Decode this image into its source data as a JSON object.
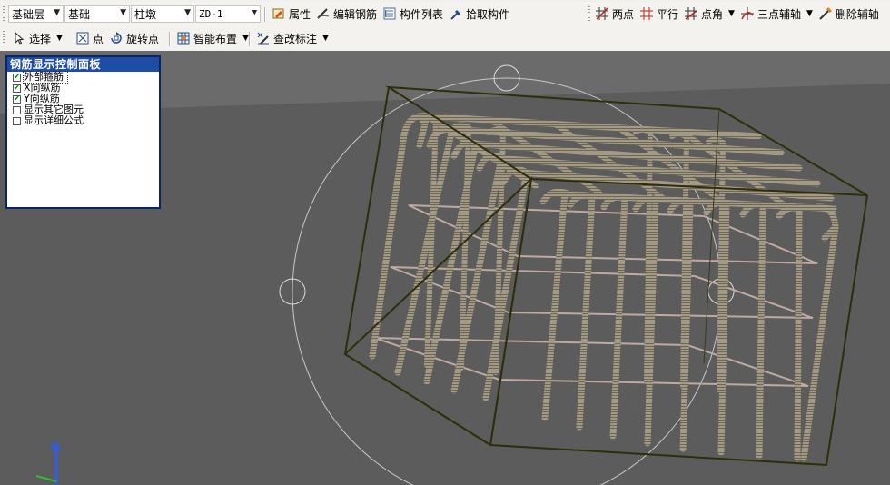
{
  "toolbar1": {
    "combos": [
      {
        "value": "基础层"
      },
      {
        "value": "基础"
      },
      {
        "value": "柱墩"
      },
      {
        "value": "ZD-1"
      }
    ],
    "buttons": [
      {
        "label": "属性",
        "icon": "properties-icon"
      },
      {
        "label": "编辑钢筋",
        "icon": "edit-rebar-icon"
      },
      {
        "label": "构件列表",
        "icon": "component-list-icon"
      },
      {
        "label": "拾取构件",
        "icon": "pick-component-icon"
      }
    ],
    "right_buttons": [
      {
        "label": "两点",
        "icon": "two-point-axis-icon"
      },
      {
        "label": "平行",
        "icon": "parallel-axis-icon"
      },
      {
        "label": "点角",
        "icon": "point-angle-axis-icon"
      },
      {
        "label": "三点辅轴",
        "icon": "three-point-axis-icon"
      },
      {
        "label": "删除辅轴",
        "icon": "delete-axis-icon"
      }
    ]
  },
  "toolbar2": {
    "buttons": [
      {
        "label": "选择",
        "icon": "select-pointer-icon"
      },
      {
        "label": "点",
        "icon": "point-icon"
      },
      {
        "label": "旋转点",
        "icon": "rotate-point-icon"
      },
      {
        "label": "智能布置",
        "icon": "smart-layout-icon"
      },
      {
        "label": "查改标注",
        "icon": "check-annotation-icon"
      }
    ]
  },
  "panel": {
    "title": "钢筋显示控制面板",
    "options": [
      {
        "label": "外部箍筋",
        "checked": true
      },
      {
        "label": "X向纵筋",
        "checked": true
      },
      {
        "label": "Y向纵筋",
        "checked": true
      },
      {
        "label": "显示其它图元",
        "checked": false
      },
      {
        "label": "显示详细公式",
        "checked": false
      }
    ]
  },
  "axis": {
    "z_label": "Z"
  },
  "colors": {
    "viewport_bg": "#5f5f5f",
    "rebar": "#a39a86",
    "box_outline": "#2e2e0a",
    "panel_title": "#1d4ea3"
  }
}
